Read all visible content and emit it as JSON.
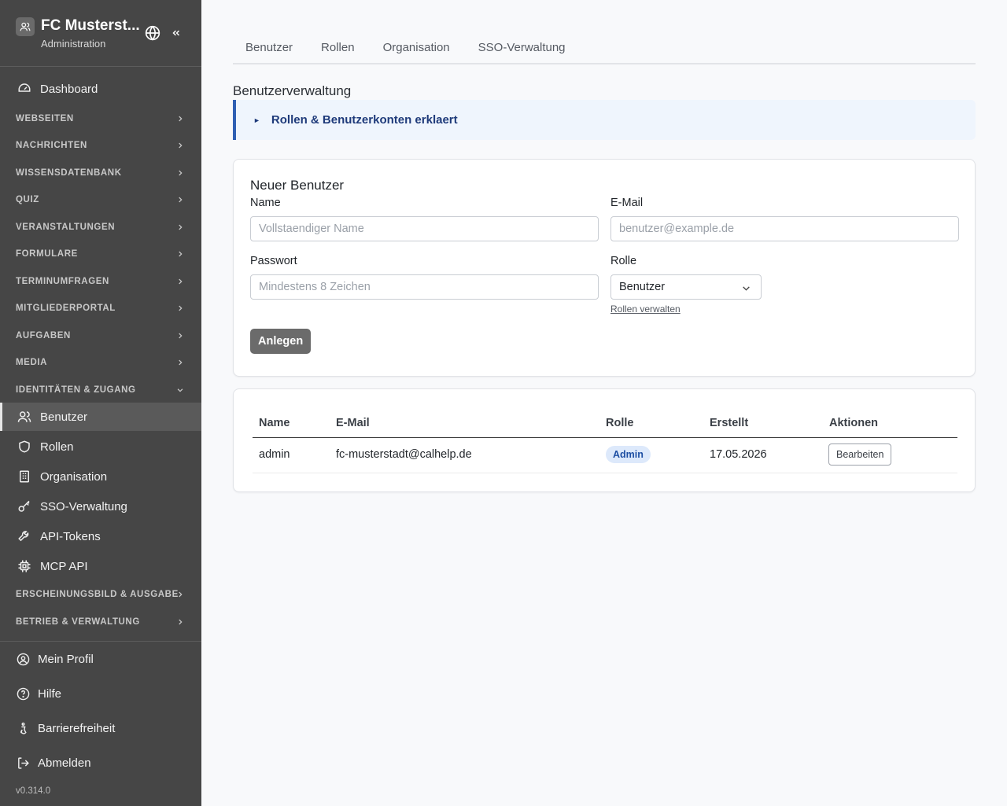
{
  "sidebar": {
    "title": "FC Musterst...",
    "subtitle": "Administration",
    "dashboard": "Dashboard",
    "groups": {
      "webseiten": "WEBSEITEN",
      "nachrichten": "NACHRICHTEN",
      "wissensdatenbank": "WISSENSDATENBANK",
      "quiz": "QUIZ",
      "veranstaltungen": "VERANSTALTUNGEN",
      "formulare": "FORMULARE",
      "terminumfragen": "TERMINUMFRAGEN",
      "mitgliederportal": "MITGLIEDERPORTAL",
      "aufgaben": "AUFGABEN",
      "media": "MEDIA",
      "identitaeten": "IDENTITÄTEN & ZUGANG",
      "erscheinungsbild": "ERSCHEINUNGSBILD & AUSGABE",
      "betrieb": "BETRIEB & VERWALTUNG"
    },
    "identity_items": {
      "benutzer": "Benutzer",
      "rollen": "Rollen",
      "organisation": "Organisation",
      "sso": "SSO-Verwaltung",
      "api_tokens": "API-Tokens",
      "mcp_api": "MCP API"
    },
    "footer": {
      "profil": "Mein Profil",
      "hilfe": "Hilfe",
      "barrierefreiheit": "Barrierefreiheit",
      "abmelden": "Abmelden"
    },
    "version": "v0.314.0"
  },
  "tabs": [
    "Benutzer",
    "Rollen",
    "Organisation",
    "SSO-Verwaltung"
  ],
  "page": {
    "heading": "Benutzerverwaltung",
    "info_box": "Rollen & Benutzerkonten erklaert"
  },
  "form": {
    "title": "Neuer Benutzer",
    "name_label": "Name",
    "name_placeholder": "Vollstaendiger Name",
    "email_label": "E-Mail",
    "email_placeholder": "benutzer@example.de",
    "password_label": "Passwort",
    "password_placeholder": "Mindestens 8 Zeichen",
    "role_label": "Rolle",
    "role_value": "Benutzer",
    "roles_link": "Rollen verwalten",
    "submit": "Anlegen"
  },
  "table": {
    "headers": {
      "name": "Name",
      "email": "E-Mail",
      "role": "Rolle",
      "created": "Erstellt",
      "actions": "Aktionen"
    },
    "rows": [
      {
        "name": "admin",
        "email": "fc-musterstadt@calhelp.de",
        "role": "Admin",
        "created": "17.05.2026",
        "action": "Bearbeiten"
      }
    ]
  },
  "colors": {
    "sidebar_bg": "#464646",
    "accent": "#2f5fb3",
    "badge_bg": "#dde9fb",
    "badge_text": "#1e4fa3"
  }
}
